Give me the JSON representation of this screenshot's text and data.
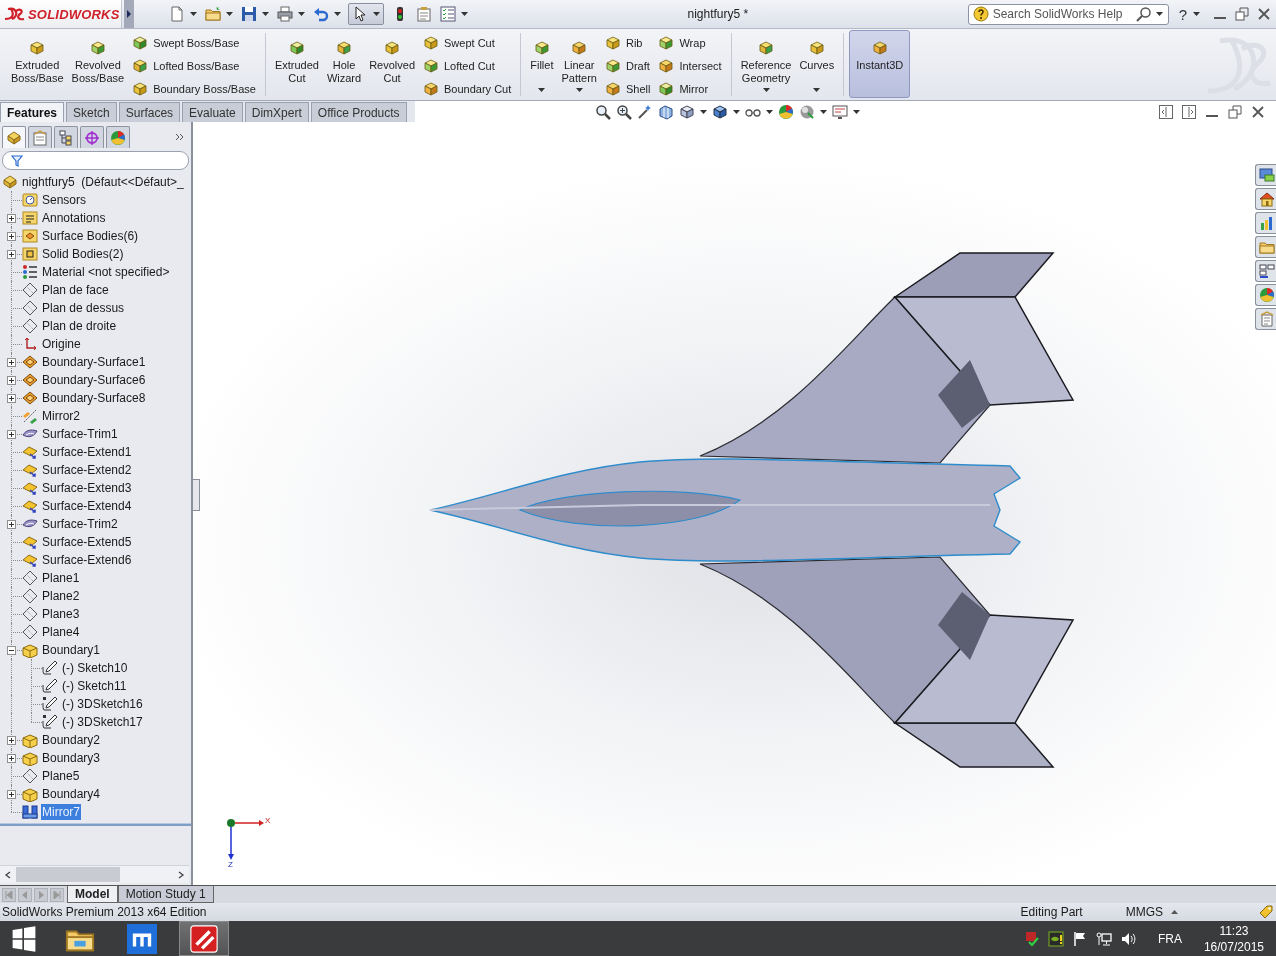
{
  "title_bar": {
    "logo": "SOLIDWORKS",
    "select_tool_on": true,
    "title": "nightfury5 *",
    "search": {
      "placeholder": "Search SolidWorks Help"
    },
    "help": "?"
  },
  "ribbon": {
    "groups": [
      {
        "items": [
          {
            "kind": "large",
            "label": "Extruded Boss/Base",
            "dropdown": false,
            "on": false
          },
          {
            "kind": "large",
            "label": "Revolved Boss/Base",
            "dropdown": false,
            "on": false
          },
          {
            "kind": "stack",
            "buttons": [
              "Swept Boss/Base",
              "Lofted Boss/Base",
              "Boundary Boss/Base"
            ]
          }
        ]
      },
      {
        "items": [
          {
            "kind": "large",
            "label": "Extruded Cut",
            "dropdown": false,
            "on": false
          },
          {
            "kind": "large",
            "label": "Hole Wizard",
            "dropdown": false,
            "on": false
          },
          {
            "kind": "large",
            "label": "Revolved Cut",
            "dropdown": false,
            "on": false
          },
          {
            "kind": "stack",
            "buttons": [
              "Swept Cut",
              "Lofted Cut",
              "Boundary Cut"
            ]
          }
        ]
      },
      {
        "items": [
          {
            "kind": "large",
            "label": "Fillet",
            "dropdown": true,
            "on": false
          },
          {
            "kind": "large",
            "label": "Linear Pattern",
            "dropdown": true,
            "on": false
          },
          {
            "kind": "stack",
            "buttons": [
              "Rib",
              "Draft",
              "Shell"
            ]
          },
          {
            "kind": "stack",
            "buttons": [
              "Wrap",
              "Intersect",
              "Mirror"
            ]
          }
        ]
      },
      {
        "items": [
          {
            "kind": "large",
            "label": "Reference Geometry",
            "dropdown": true,
            "on": false
          },
          {
            "kind": "large",
            "label": "Curves",
            "dropdown": true,
            "on": false
          }
        ]
      },
      {
        "items": [
          {
            "kind": "large",
            "label": "Instant3D",
            "dropdown": false,
            "on": true
          }
        ]
      }
    ]
  },
  "command_tabs": [
    {
      "label": "Features",
      "selected": true
    },
    {
      "label": "Sketch",
      "selected": false
    },
    {
      "label": "Surfaces",
      "selected": false
    },
    {
      "label": "Evaluate",
      "selected": false
    },
    {
      "label": "DimXpert",
      "selected": false
    },
    {
      "label": "Office Products",
      "selected": false
    }
  ],
  "feature_tree": {
    "panel_tabs": [
      {
        "kind": "features",
        "selected": true
      },
      {
        "kind": "properties",
        "selected": false
      },
      {
        "kind": "configurations",
        "selected": false
      },
      {
        "kind": "dimxpert",
        "selected": false
      },
      {
        "kind": "display",
        "selected": false
      }
    ],
    "root": {
      "kind": "part",
      "label": "nightfury5  (Défaut<<Défaut>_",
      "selected": false,
      "children": [
        {
          "kind": "sensors",
          "label": "Sensors",
          "selected": false
        },
        {
          "kind": "annotations",
          "label": "Annotations",
          "expanded": false,
          "selected": false
        },
        {
          "kind": "surfaces",
          "label": "Surface Bodies(6)",
          "expanded": false,
          "selected": false
        },
        {
          "kind": "solids",
          "label": "Solid Bodies(2)",
          "expanded": false,
          "selected": false
        },
        {
          "kind": "material",
          "label": "Material <not specified>",
          "selected": false
        },
        {
          "kind": "plane",
          "label": "Plan de face",
          "selected": false
        },
        {
          "kind": "plane",
          "label": "Plan de dessus",
          "selected": false
        },
        {
          "kind": "plane",
          "label": "Plan de droite",
          "selected": false
        },
        {
          "kind": "origin",
          "label": "Origine",
          "selected": false
        },
        {
          "kind": "surface",
          "label": "Boundary-Surface1",
          "expanded": false,
          "selected": false
        },
        {
          "kind": "surface",
          "label": "Boundary-Surface6",
          "expanded": false,
          "selected": false
        },
        {
          "kind": "surface",
          "label": "Boundary-Surface8",
          "expanded": false,
          "selected": false
        },
        {
          "kind": "mirror",
          "label": "Mirror2",
          "selected": false
        },
        {
          "kind": "trim",
          "label": "Surface-Trim1",
          "expanded": false,
          "selected": false
        },
        {
          "kind": "extend",
          "label": "Surface-Extend1",
          "selected": false
        },
        {
          "kind": "extend",
          "label": "Surface-Extend2",
          "selected": false
        },
        {
          "kind": "extend",
          "label": "Surface-Extend3",
          "selected": false
        },
        {
          "kind": "extend",
          "label": "Surface-Extend4",
          "selected": false
        },
        {
          "kind": "trim",
          "label": "Surface-Trim2",
          "expanded": false,
          "selected": false
        },
        {
          "kind": "extend",
          "label": "Surface-Extend5",
          "selected": false
        },
        {
          "kind": "extend",
          "label": "Surface-Extend6",
          "selected": false
        },
        {
          "kind": "plane",
          "label": "Plane1",
          "selected": false
        },
        {
          "kind": "plane",
          "label": "Plane2",
          "selected": false
        },
        {
          "kind": "plane",
          "label": "Plane3",
          "selected": false
        },
        {
          "kind": "plane",
          "label": "Plane4",
          "selected": false
        },
        {
          "kind": "boundary",
          "label": "Boundary1",
          "expanded": true,
          "selected": false,
          "children": [
            {
              "kind": "sketch",
              "label": "(-) Sketch10",
              "selected": false
            },
            {
              "kind": "sketch",
              "label": "(-) Sketch11",
              "selected": false
            },
            {
              "kind": "sketch3d",
              "label": "(-) 3DSketch16",
              "selected": false
            },
            {
              "kind": "sketch3d",
              "label": "(-) 3DSketch17",
              "selected": false
            }
          ]
        },
        {
          "kind": "boundary",
          "label": "Boundary2",
          "expanded": false,
          "selected": false
        },
        {
          "kind": "boundary",
          "label": "Boundary3",
          "expanded": false,
          "selected": false
        },
        {
          "kind": "plane",
          "label": "Plane5",
          "selected": false
        },
        {
          "kind": "boundary",
          "label": "Boundary4",
          "expanded": false,
          "selected": false
        },
        {
          "kind": "bodymirror",
          "label": "Mirror7",
          "selected": true
        }
      ]
    }
  },
  "triad": {
    "x_label": "X",
    "z_label": "Z"
  },
  "bottom_tabs": [
    {
      "label": "Model",
      "selected": true
    },
    {
      "label": "Motion Study 1",
      "selected": false
    }
  ],
  "status_bar": {
    "edition": "SolidWorks Premium 2013 x64 Edition",
    "mode": "Editing Part",
    "units": "MMGS"
  },
  "taskbar": {
    "apps": [
      {
        "kind": "explorer",
        "active": false
      },
      {
        "kind": "tile",
        "active": false
      },
      {
        "kind": "solidworks",
        "active": true
      }
    ],
    "language": "FRA",
    "time": "11:23",
    "date": "16/07/2015"
  }
}
